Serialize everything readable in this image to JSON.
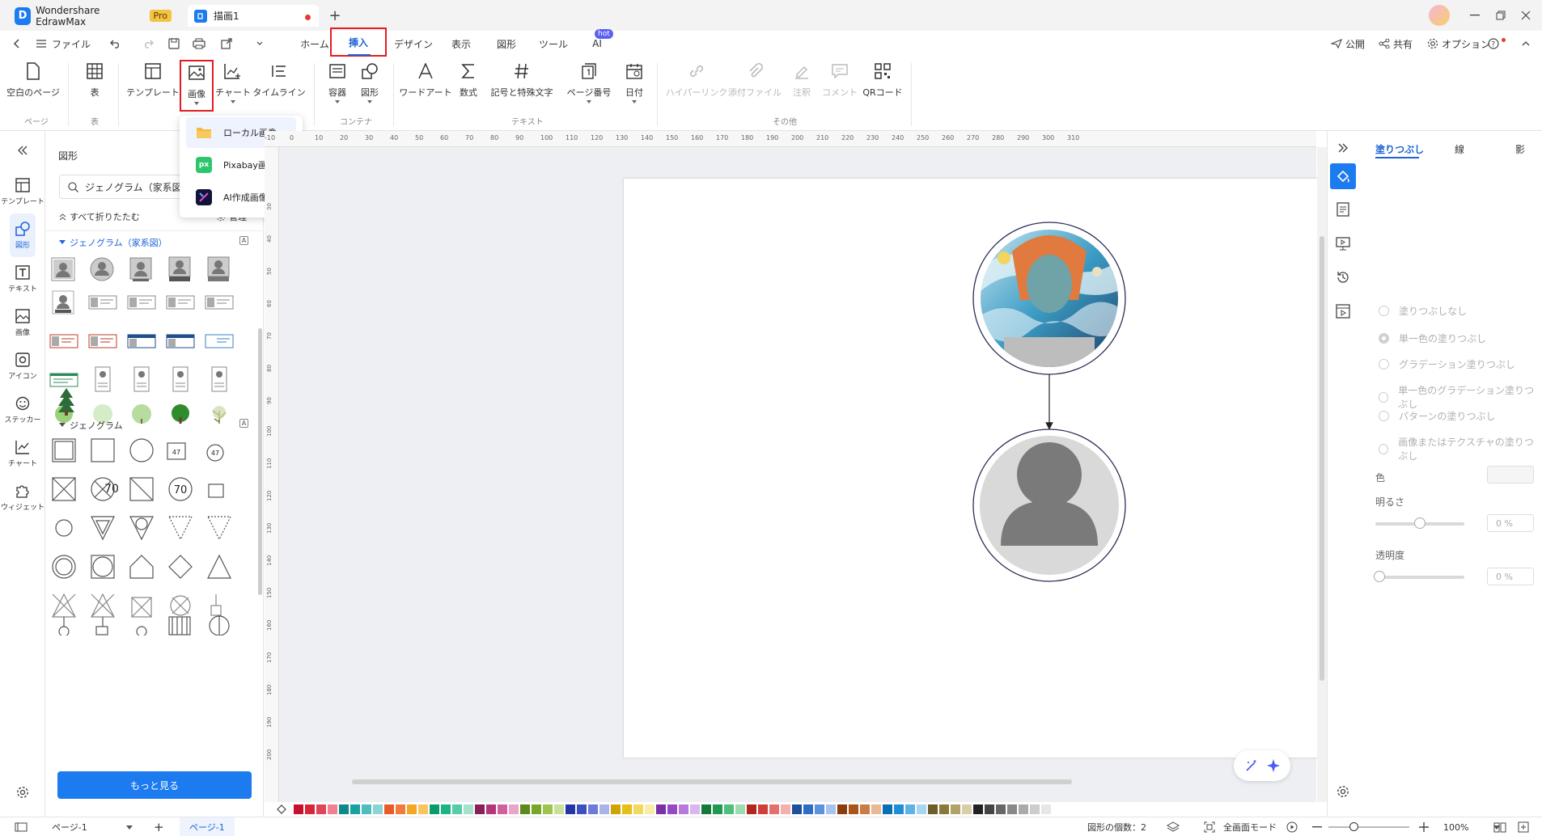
{
  "app": {
    "name": "Wondershare EdrawMax",
    "badge": "Pro",
    "doc_tab": "描画1",
    "new_tab": "+"
  },
  "menu": {
    "file": "ファイル",
    "tabs": [
      "ホーム",
      "挿入",
      "デザイン",
      "表示",
      "図形",
      "ツール",
      "AI"
    ],
    "active_tab": "挿入",
    "ai_badge": "hot",
    "publish": "公開",
    "share": "共有",
    "options": "オプション"
  },
  "ribbon": {
    "blank_page": "空白のページ",
    "table": "表",
    "template": "テンプレート",
    "image": "画像",
    "chart": "チャート",
    "timeline": "タイムライン",
    "container": "容器",
    "shape": "図形",
    "wordart": "ワードアート",
    "formula": "数式",
    "symbols": "記号と特殊文字",
    "page_number": "ページ番号",
    "date": "日付",
    "hyperlink": "ハイパーリンク",
    "attachment": "添付ファイル",
    "note": "注釈",
    "comment": "コメント",
    "qr": "QRコード",
    "groups": {
      "page": "ページ",
      "table": "表",
      "container": "コンテナ",
      "text": "テキスト",
      "other": "その他"
    }
  },
  "image_menu": {
    "items": [
      "ローカル画像",
      "Pixabay画像",
      "AI作成画像"
    ]
  },
  "leftbar": {
    "items": [
      "テンプレート",
      "図形",
      "テキスト",
      "画像",
      "アイコン",
      "ステッカー",
      "チャート",
      "ウィジェット"
    ]
  },
  "shapes_panel": {
    "title": "図形",
    "search": "ジェノグラム（家系図）",
    "collapse_all": "すべて折りたたむ",
    "manage": "管理",
    "cat1": "ジェノグラム（家系図）",
    "cat2": "ジェノグラム",
    "more_button": "もっと見る",
    "sample_70a": "70",
    "sample_70b": "70",
    "sample_47a": "47",
    "sample_47b": "47"
  },
  "ruler": {
    "h": [
      "-10",
      "0",
      "10",
      "20",
      "30",
      "40",
      "50",
      "60",
      "70",
      "80",
      "90",
      "100",
      "110",
      "120",
      "130",
      "140",
      "150",
      "160",
      "170",
      "180",
      "190",
      "200",
      "210",
      "220",
      "230",
      "240",
      "250",
      "260",
      "270",
      "280",
      "290",
      "300",
      "310"
    ],
    "v": [
      "30",
      "40",
      "50",
      "60",
      "70",
      "80",
      "90",
      "100",
      "110",
      "120",
      "130",
      "140",
      "150",
      "160",
      "170",
      "180",
      "190",
      "200"
    ]
  },
  "props": {
    "tabs": [
      "塗りつぶし",
      "線",
      "影"
    ],
    "fill_options": [
      "塗りつぶしなし",
      "単一色の塗りつぶし",
      "グラデーション塗りつぶし",
      "単一色のグラデーション塗りつぶし",
      "パターンの塗りつぶし",
      "画像またはテクスチャの塗りつぶし"
    ],
    "color_label": "色",
    "brightness_label": "明るさ",
    "brightness_value": "0 %",
    "transparency_label": "透明度",
    "transparency_value": "0 %"
  },
  "status": {
    "page_select": "ページ-1",
    "page_tab": "ページ-1",
    "shape_count": "図形の個数：2",
    "fullscreen": "全画面モード",
    "zoom": "100%",
    "add": "+"
  },
  "palette": [
    "#c8102e",
    "#d6263c",
    "#e0455a",
    "#f27f93",
    "#0c8a8a",
    "#1aa2a2",
    "#4dbdbd",
    "#8fd4d4",
    "#e85b2a",
    "#f27b3c",
    "#f5a623",
    "#f9c45b",
    "#0a9b6b",
    "#1bb585",
    "#58cba7",
    "#a3e2cb",
    "#8b1f5a",
    "#b3357a",
    "#d15f9e",
    "#eaa4c9",
    "#5b8a1a",
    "#77a628",
    "#9cc44f",
    "#c9e09a",
    "#2436a6",
    "#3d50c2",
    "#6d7bd8",
    "#aab3ea",
    "#d0a400",
    "#e6bf19",
    "#f2d85c",
    "#f8ecaa",
    "#7b2fa8",
    "#9748c7",
    "#b779db",
    "#d9b7ee",
    "#137a3c",
    "#1f9a50",
    "#4fbf79",
    "#9ddcb3",
    "#b3261e",
    "#d0403a",
    "#e4706c",
    "#f3b0ad",
    "#1c4f9c",
    "#2f6cc4",
    "#5f92dc",
    "#a6c4ee",
    "#8a3c0a",
    "#a9551a",
    "#c97c45",
    "#e7b994",
    "#0a6fb5",
    "#1e8fd6",
    "#5fb2e6",
    "#a8d6f2",
    "#6b5e2a",
    "#8a7a3a",
    "#b0a36a",
    "#d8cfa8",
    "#222222",
    "#444444",
    "#666666",
    "#888888",
    "#aaaaaa",
    "#cccccc",
    "#e6e6e6"
  ]
}
